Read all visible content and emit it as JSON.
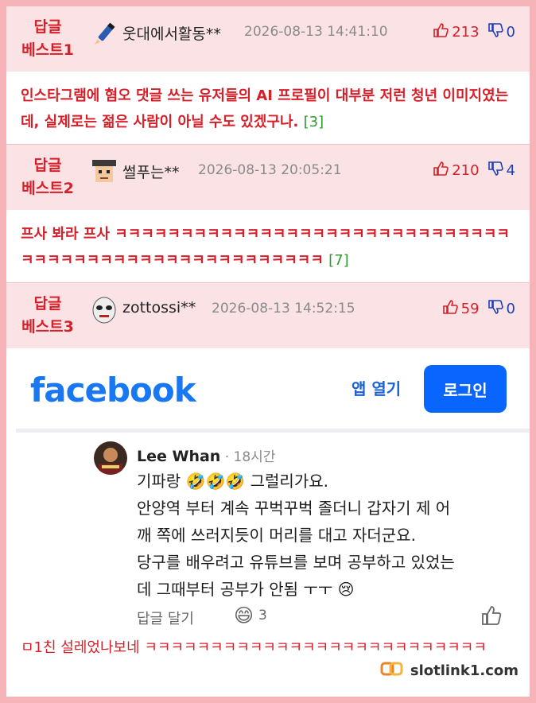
{
  "comments": [
    {
      "badge_line1": "답글",
      "badge_line2": "베스트1",
      "avatar_icon": "pencil-icon",
      "username": "웃대에서활동**",
      "datetime": "2026-08-13 14:41:10",
      "upvotes": "213",
      "downvotes": "0",
      "body": "인스타그램에 혐오 댓글 쓰는 유저들의 AI 프로필이 대부분 저런 청년 이미지였는데, 실제로는 젊은 사람이 아닐 수도 있겠구나.",
      "reply_count": "[3]"
    },
    {
      "badge_line1": "답글",
      "badge_line2": "베스트2",
      "avatar_icon": "pixel-face-icon",
      "username": "썰푸는**",
      "datetime": "2026-08-13 20:05:21",
      "upvotes": "210",
      "downvotes": "4",
      "body": "프사 봐라 프사 ㅋㅋㅋㅋㅋㅋㅋㅋㅋㅋㅋㅋㅋㅋㅋㅋㅋㅋㅋㅋㅋㅋㅋㅋㅋㅋㅋㅋㅋㅋㅋㅋㅋㅋㅋㅋㅋㅋㅋㅋㅋㅋㅋㅋㅋㅋㅋㅋㅋㅋㅋㅋㅋ",
      "reply_count": "[7]"
    },
    {
      "badge_line1": "답글",
      "badge_line2": "베스트3",
      "avatar_icon": "mask-face-icon",
      "username": "zottossi**",
      "datetime": "2026-08-13 14:52:15",
      "upvotes": "59",
      "downvotes": "0",
      "body": "ㅁ1친 설레었나보네 ㅋㅋㅋㅋㅋㅋㅋㅋㅋㅋㅋㅋㅋㅋㅋㅋㅋㅋㅋㅋㅋㅋㅋㅋㅋㅋ"
    }
  ],
  "facebook": {
    "logo": "facebook",
    "open_app": "앱 열기",
    "login": "로그인",
    "commenter": "Lee Whan",
    "time": " · 18시간",
    "lines": [
      "기파랑 🤣🤣🤣 그럴리가요.",
      "안양역 부터 계속 꾸벅꾸벅 졸더니 갑자기 제 어",
      "깨 쪽에 쓰러지듯이 머리를 대고 자더군요.",
      "당구를 배우려고 유튜브를 보며 공부하고 있었는",
      "데 그때부터 공부가 안됨 ㅜㅜ 😢"
    ],
    "reply_label": "답글 달기",
    "reaction_emoji": "😄",
    "reaction_count": "3"
  },
  "watermark": "slotlink1.com",
  "colors": {
    "accent_red": "#d61f28",
    "down_blue": "#1b3fb8",
    "header_bg": "#fbe3e5",
    "page_border": "#f6b3b8",
    "fb_blue": "#1877f2"
  }
}
